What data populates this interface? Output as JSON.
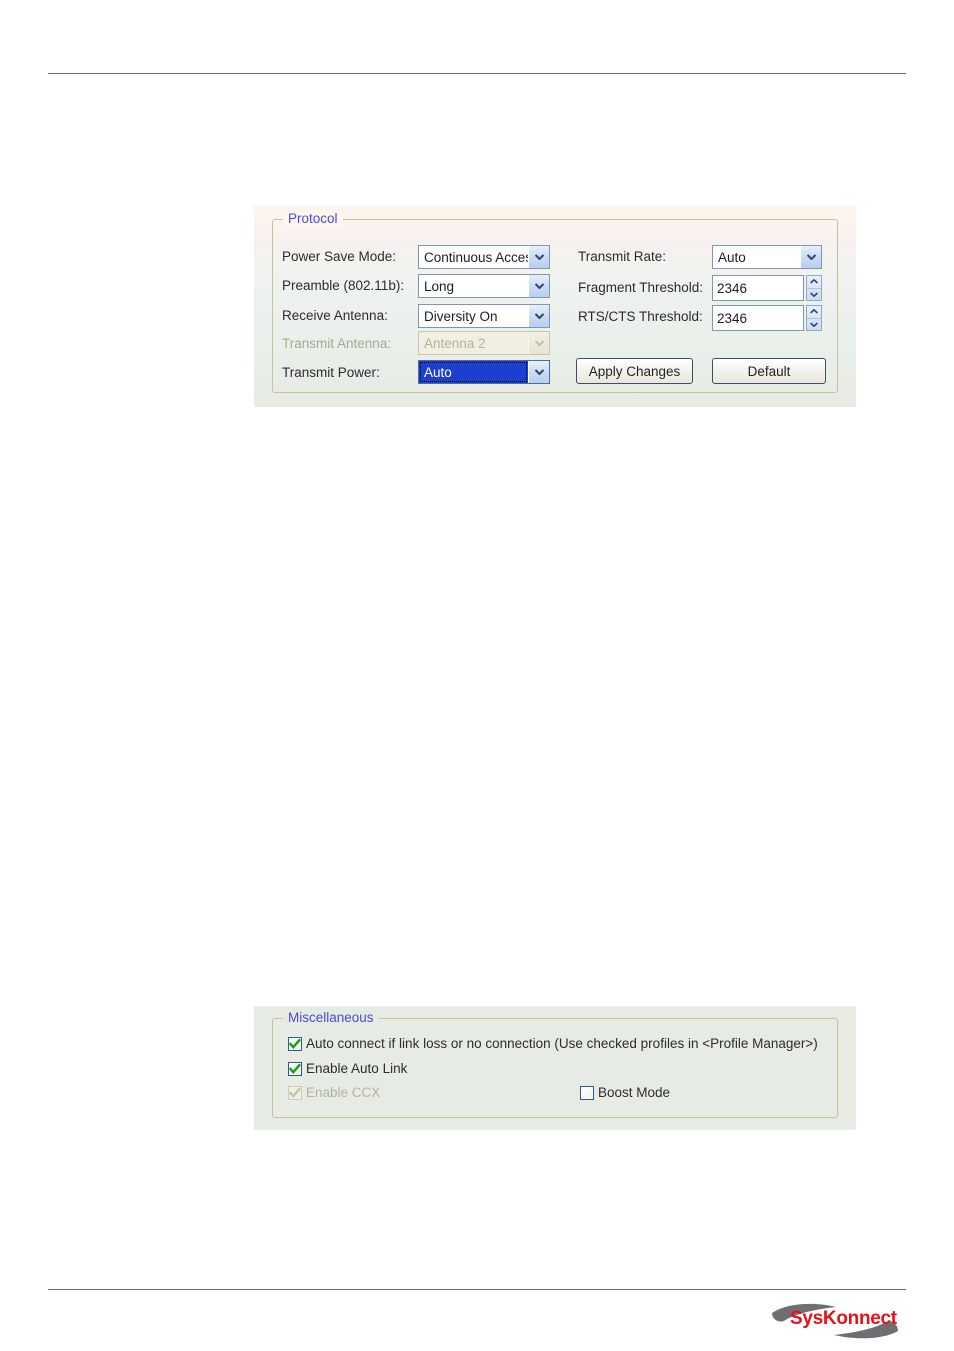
{
  "page": {
    "background": "#ffffff",
    "rule_color": "#6e6e76"
  },
  "protocol_panel": {
    "title": "Protocol",
    "title_color": "#4a4ad8",
    "fields": [
      {
        "label": "Power Save Mode:",
        "value": "Continuous Access",
        "control": "combobox",
        "state": "enabled"
      },
      {
        "label": "Preamble (802.11b):",
        "value": "Long",
        "control": "combobox",
        "state": "enabled"
      },
      {
        "label": "Receive Antenna:",
        "value": "Diversity On",
        "control": "combobox",
        "state": "enabled"
      },
      {
        "label": "Transmit Antenna:",
        "value": "Antenna 2",
        "control": "combobox",
        "state": "disabled"
      },
      {
        "label": "Transmit Power:",
        "value": "Auto",
        "control": "combobox",
        "state": "focused"
      }
    ],
    "fields_right": [
      {
        "label": "Transmit Rate:",
        "value": "Auto",
        "control": "combobox",
        "state": "enabled"
      },
      {
        "label": "Fragment Threshold:",
        "value": "2346",
        "control": "spinner",
        "state": "enabled"
      },
      {
        "label": "RTS/CTS Threshold:",
        "value": "2346",
        "control": "spinner",
        "state": "enabled"
      }
    ],
    "buttons": {
      "apply": "Apply Changes",
      "default": "Default"
    },
    "selection_color": "#1c3fd1"
  },
  "misc_panel": {
    "title": "Miscellaneous",
    "title_color": "#4a4ad8",
    "checkboxes": [
      {
        "label": "Auto connect if link loss or no connection (Use checked profiles in <Profile Manager>)",
        "checked": true,
        "enabled": true
      },
      {
        "label": "Enable Auto Link",
        "checked": true,
        "enabled": true
      },
      {
        "label": "Enable CCX",
        "checked": true,
        "enabled": false
      },
      {
        "label": "Boost Mode",
        "checked": false,
        "enabled": true
      }
    ],
    "check_color": "#11a011"
  },
  "footer": {
    "logo_text": "SysKonnect",
    "logo_color": "#e8101a"
  }
}
